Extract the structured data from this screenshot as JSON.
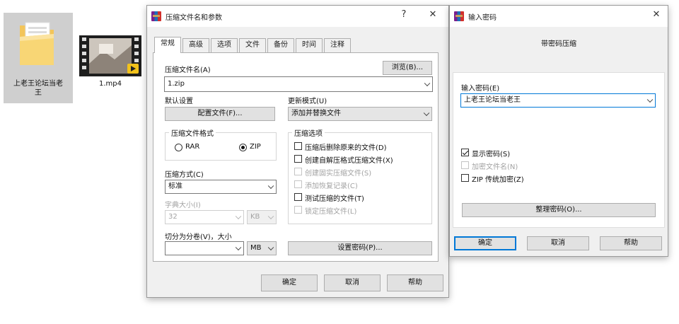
{
  "desktop": {
    "items": [
      {
        "label_line1": "上老王论坛当老",
        "label_line2": "王",
        "icon": "folder-icon"
      },
      {
        "label_line1": "1.mp4",
        "icon": "video-file-icon"
      }
    ]
  },
  "archive_dialog": {
    "title": "压缩文件名和参数",
    "help_glyph": "?",
    "close_glyph": "✕",
    "tabs": [
      "常规",
      "高级",
      "选项",
      "文件",
      "备份",
      "时间",
      "注释"
    ],
    "archive_name_label": "压缩文件名(A)",
    "browse_label": "浏览(B)...",
    "archive_name_value": "1.zip",
    "default_settings_label": "默认设置",
    "profiles_label": "配置文件(F)...",
    "update_mode_label": "更新模式(U)",
    "update_mode_value": "添加并替换文件",
    "format_group_label": "压缩文件格式",
    "format_rar": "RAR",
    "format_zip": "ZIP",
    "format_selected": "ZIP",
    "method_label": "压缩方式(C)",
    "method_value": "标准",
    "dict_label": "字典大小(I)",
    "dict_value": "32",
    "dict_unit": "KB",
    "split_label": "切分为分卷(V)，大小",
    "split_value": "",
    "split_unit": "MB",
    "options_group_label": "压缩选项",
    "options": [
      {
        "label": "压缩后删除原来的文件(D)",
        "checked": false,
        "enabled": true
      },
      {
        "label": "创建自解压格式压缩文件(X)",
        "checked": false,
        "enabled": true
      },
      {
        "label": "创建固实压缩文件(S)",
        "checked": false,
        "enabled": false
      },
      {
        "label": "添加恢复记录(C)",
        "checked": false,
        "enabled": false
      },
      {
        "label": "测试压缩的文件(T)",
        "checked": false,
        "enabled": true
      },
      {
        "label": "锁定压缩文件(L)",
        "checked": false,
        "enabled": false
      }
    ],
    "set_password_label": "设置密码(P)...",
    "ok_label": "确定",
    "cancel_label": "取消",
    "help_label": "帮助"
  },
  "password_dialog": {
    "title": "输入密码",
    "close_glyph": "✕",
    "subtitle": "带密码压缩",
    "password_label": "输入密码(E)",
    "password_value": "上老王论坛当老王",
    "show_password_label": "显示密码(S)",
    "show_password_checked": true,
    "encrypt_names_label": "加密文件名(N)",
    "encrypt_names_enabled": false,
    "zip_legacy_label": "ZIP 传统加密(Z)",
    "zip_legacy_checked": false,
    "organize_label": "整理密码(O)...",
    "ok_label": "确定",
    "cancel_label": "取消",
    "help_label": "帮助"
  }
}
